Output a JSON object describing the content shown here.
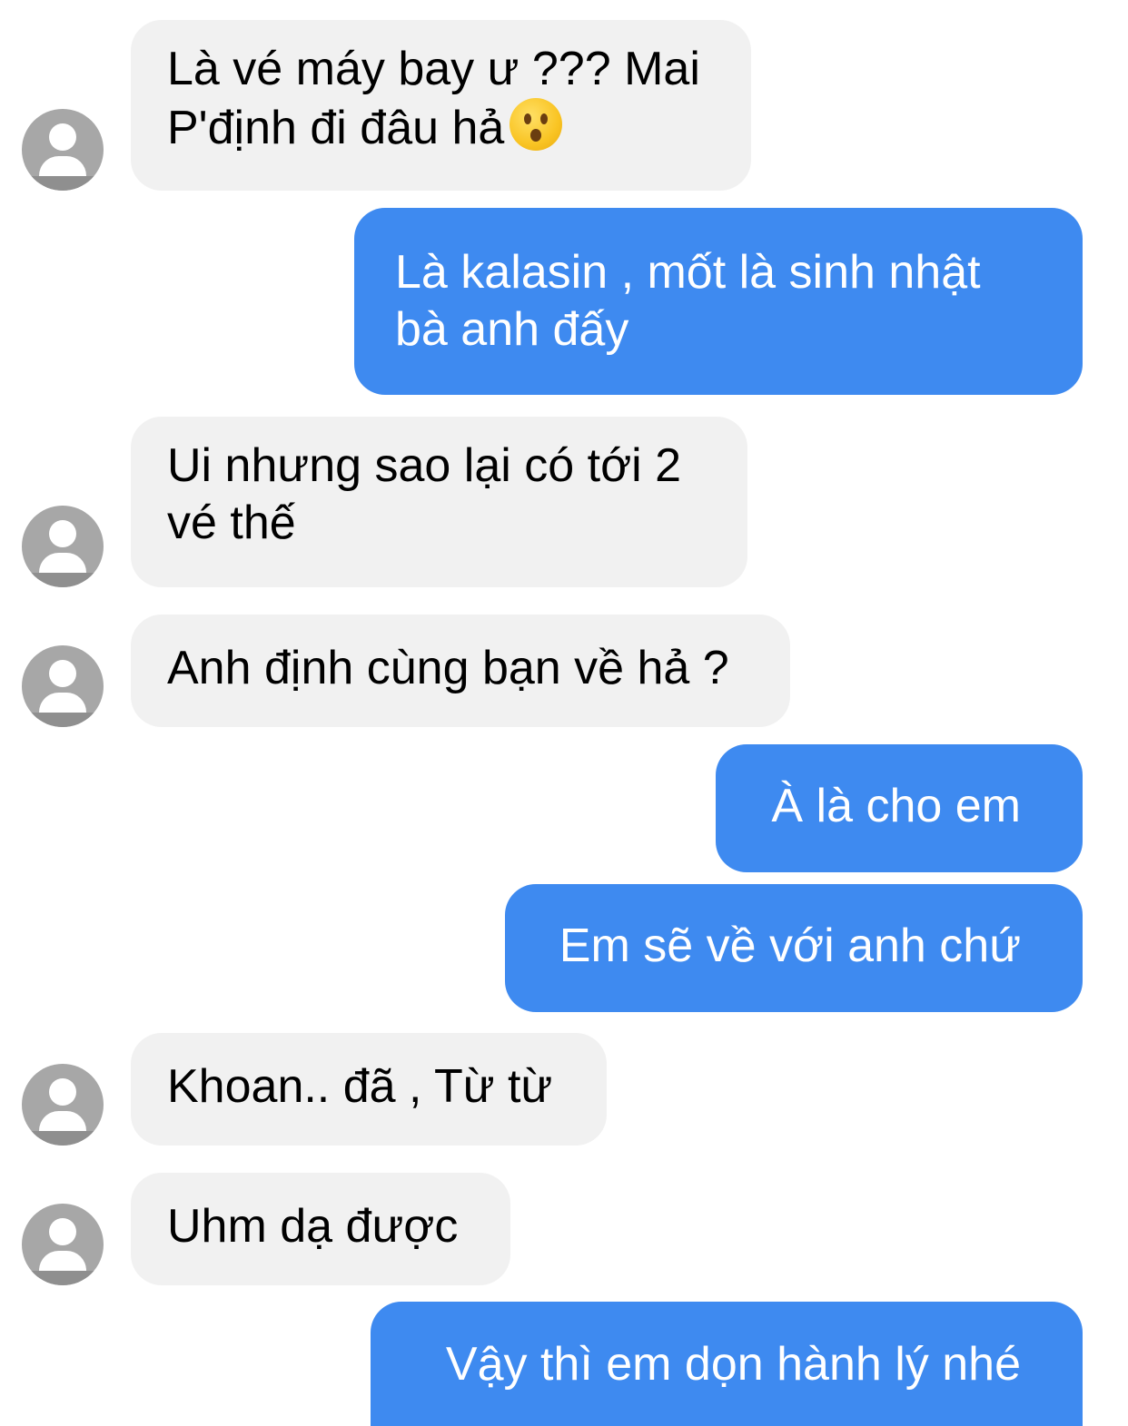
{
  "messages": [
    {
      "side": "incoming",
      "text": "Là vé máy bay ư ??? Mai\nP'định đi đâu hả",
      "emoji": "hushed-face-emoji"
    },
    {
      "side": "outgoing",
      "text": "Là kalasin , mốt là sinh nhật\nbà anh đấy"
    },
    {
      "side": "incoming",
      "text": "Ui nhưng sao lại có tới 2\nvé thế"
    },
    {
      "side": "incoming",
      "text": "Anh định cùng bạn về hả ?"
    },
    {
      "side": "outgoing",
      "text": "À là cho em"
    },
    {
      "side": "outgoing",
      "text": "Em sẽ về với anh chứ"
    },
    {
      "side": "incoming",
      "text": "Khoan.. đã , Từ từ"
    },
    {
      "side": "incoming",
      "text": "Uhm dạ được"
    },
    {
      "side": "outgoing",
      "text": "Vậy thì em dọn hành lý nhé"
    }
  ],
  "colors": {
    "incoming_bubble": "#f1f1f1",
    "outgoing_bubble": "#3e8af0",
    "incoming_text": "#000000",
    "outgoing_text": "#ffffff",
    "avatar": "#a7a7a7"
  },
  "icons": {
    "avatar": "default-avatar-icon",
    "emoji": "hushed-face-emoji"
  }
}
